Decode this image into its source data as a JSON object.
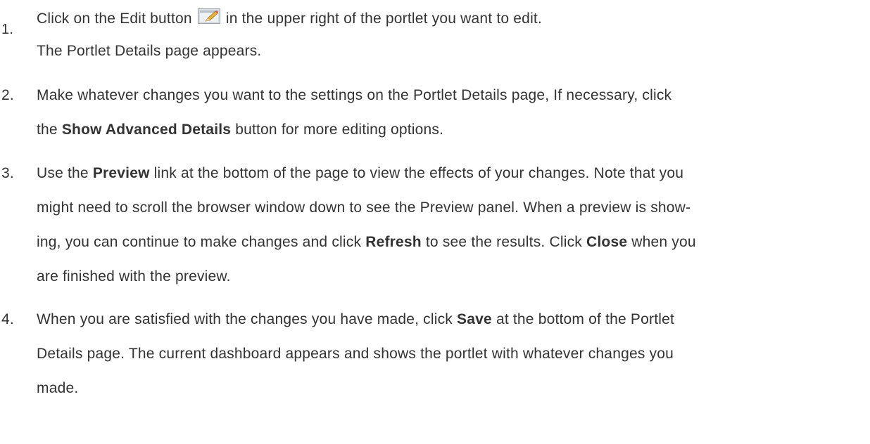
{
  "steps": [
    {
      "number": "1.",
      "lines": [
        {
          "before": "Click on the Edit button",
          "icon": "edit-icon",
          "after": "in the upper right of the portlet you want to edit."
        },
        {
          "text": "The Portlet Details page appears."
        }
      ]
    },
    {
      "number": "2.",
      "line1": "Make whatever changes you want to the settings on the Portlet Details page, If necessary, click",
      "line2_pre": "the",
      "line2_bold": "Show Advanced Details",
      "line2_post": "button for more editing options."
    },
    {
      "number": "3.",
      "line1_pre": "Use the",
      "line1_bold": "Preview",
      "line1_post": "link at the bottom of the page to view the effects of your changes. Note that you",
      "line2": "might need to scroll the browser window down to see the Preview panel. When a preview is show-",
      "line3_pre": "ing, you can continue to make changes and click",
      "line3_bold1": "Refresh",
      "line3_mid": "to see the results. Click",
      "line3_bold2": "Close",
      "line3_post": "when you",
      "line4": "are finished with the preview."
    },
    {
      "number": "4.",
      "line1_pre": "When you are satisfied with the changes you have made, click",
      "line1_bold": "Save",
      "line1_post": "at the bottom of the Portlet",
      "line2": "Details page. The current dashboard appears and shows the portlet with whatever changes you",
      "line3": "made."
    }
  ]
}
